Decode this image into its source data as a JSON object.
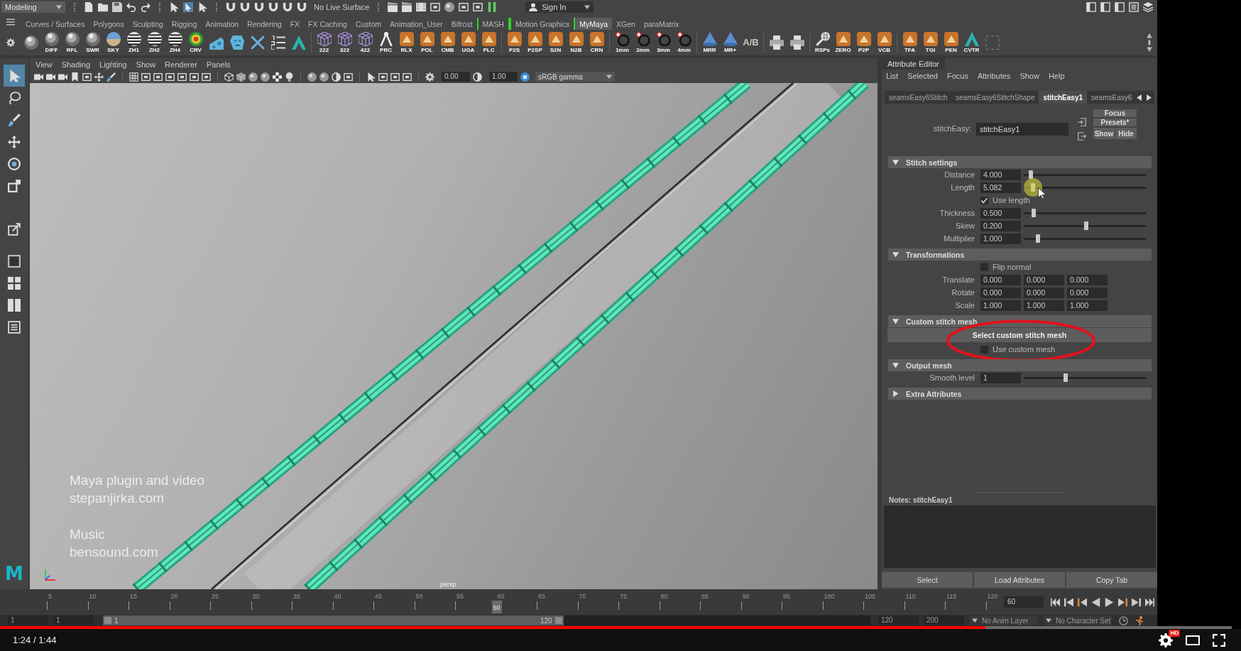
{
  "status_line": {
    "workspace": "Modeling",
    "live_surface": "No Live Surface",
    "sign_in": "Sign In"
  },
  "shelf": {
    "tabs": [
      {
        "label": "Curves / Surfaces",
        "selected": false,
        "bracketed": false
      },
      {
        "label": "Polygons",
        "selected": false,
        "bracketed": false
      },
      {
        "label": "Sculpting",
        "selected": false,
        "bracketed": false
      },
      {
        "label": "Rigging",
        "selected": false,
        "bracketed": false
      },
      {
        "label": "Animation",
        "selected": false,
        "bracketed": false
      },
      {
        "label": "Rendering",
        "selected": false,
        "bracketed": false
      },
      {
        "label": "FX",
        "selected": false,
        "bracketed": false
      },
      {
        "label": "FX Caching",
        "selected": false,
        "bracketed": false
      },
      {
        "label": "Custom",
        "selected": false,
        "bracketed": false
      },
      {
        "label": "Animation_User",
        "selected": false,
        "bracketed": false
      },
      {
        "label": "Bifrost",
        "selected": false,
        "bracketed": false
      },
      {
        "label": "MASH",
        "selected": false,
        "bracketed": true
      },
      {
        "label": "Motion Graphics",
        "selected": false,
        "bracketed": true
      },
      {
        "label": "MyMaya",
        "selected": true,
        "bracketed": false
      },
      {
        "label": "XGen",
        "selected": false,
        "bracketed": false
      },
      {
        "label": "paraMatrix",
        "selected": false,
        "bracketed": false
      }
    ],
    "groups": [
      [
        {
          "kind": "ball"
        },
        {
          "kind": "ball",
          "label": "DIFF"
        },
        {
          "kind": "ball",
          "label": "RFL"
        },
        {
          "kind": "ball",
          "label": "SWR"
        },
        {
          "kind": "sky",
          "label": "SKY"
        },
        {
          "kind": "zebra",
          "label": "ZH1"
        },
        {
          "kind": "zebra",
          "label": "ZH2"
        },
        {
          "kind": "zebra",
          "label": "ZH4"
        },
        {
          "kind": "rainbow",
          "label": "CRV"
        },
        {
          "kind": "wedge"
        },
        {
          "kind": "head"
        },
        {
          "kind": "tools"
        },
        {
          "kind": "list"
        },
        {
          "kind": "arch"
        }
      ],
      [
        {
          "kind": "cube",
          "label": "222"
        },
        {
          "kind": "cube",
          "label": "322"
        },
        {
          "kind": "cube",
          "label": "422"
        },
        {
          "kind": "compass",
          "label": "PRC"
        },
        {
          "kind": "tile",
          "label": "RLX"
        },
        {
          "kind": "tile",
          "label": "POL"
        },
        {
          "kind": "tile",
          "label": "CMB"
        },
        {
          "kind": "tile",
          "label": "UGA"
        },
        {
          "kind": "tile",
          "label": "PLC"
        }
      ],
      [
        {
          "kind": "tile",
          "label": "P2S"
        },
        {
          "kind": "tile",
          "label": "P2SP"
        },
        {
          "kind": "tile",
          "label": "S2N"
        },
        {
          "kind": "tile",
          "label": "N2B"
        },
        {
          "kind": "tile",
          "label": "CRN"
        }
      ],
      [
        {
          "kind": "ring",
          "label": "1mm"
        },
        {
          "kind": "ring",
          "label": "2mm"
        },
        {
          "kind": "ring",
          "label": "3mm"
        },
        {
          "kind": "ring",
          "label": "4mm"
        }
      ],
      [
        {
          "kind": "cone",
          "label": "MRR"
        },
        {
          "kind": "cone",
          "label": "MR+"
        },
        {
          "kind": "letters",
          "label": "A/B"
        }
      ],
      [
        {
          "kind": "printer"
        },
        {
          "kind": "printer"
        }
      ],
      [
        {
          "kind": "mic",
          "label": "RSPs"
        },
        {
          "kind": "tile",
          "label": "ZERO"
        },
        {
          "kind": "tile",
          "label": "P2P"
        },
        {
          "kind": "tile",
          "label": "VCB"
        }
      ],
      [
        {
          "kind": "tile",
          "label": "TFA"
        },
        {
          "kind": "tile",
          "label": "TGI"
        },
        {
          "kind": "tile",
          "label": "PEN"
        },
        {
          "kind": "arch",
          "label": "CVTR"
        },
        {
          "kind": "slot"
        }
      ]
    ]
  },
  "toolbox": {
    "groups": [
      [
        {
          "kind": "select",
          "selected": true
        },
        {
          "kind": "lasso",
          "selected": false
        },
        {
          "kind": "paint",
          "selected": false
        },
        {
          "kind": "move",
          "selected": false
        },
        {
          "kind": "rotate",
          "selected": false
        },
        {
          "kind": "scale",
          "selected": false
        }
      ],
      [
        {
          "kind": "last",
          "selected": false
        }
      ],
      [
        {
          "kind": "single",
          "selected": false
        },
        {
          "kind": "four",
          "selected": false
        },
        {
          "kind": "two",
          "selected": false
        },
        {
          "kind": "outliner",
          "selected": false
        }
      ]
    ],
    "logo": "M"
  },
  "viewport": {
    "menu": [
      "View",
      "Shading",
      "Lighting",
      "Show",
      "Renderer",
      "Panels"
    ],
    "exposure": "0.00",
    "gamma": "1.00",
    "color_space": "sRGB gamma",
    "captions": [
      [
        "Maya plugin and video",
        "stepanjirka.com"
      ],
      [
        "Music",
        "bensound.com"
      ]
    ],
    "camera": "persp"
  },
  "attribute_editor": {
    "title": "Attribute Editor",
    "menu": [
      "List",
      "Selected",
      "Focus",
      "Attributes",
      "Show",
      "Help"
    ],
    "node_tabs": [
      {
        "label": "seamsEasy6Stitch",
        "selected": false
      },
      {
        "label": "seamsEasy6StitchShape",
        "selected": false
      },
      {
        "label": "stitchEasy1",
        "selected": true
      },
      {
        "label": "seamsEasy6",
        "selected": false
      }
    ],
    "node_label": "stitchEasy:",
    "node_name": "stitchEasy1",
    "actions": [
      "Focus",
      "Presets*"
    ],
    "visibility": [
      "Show",
      "Hide"
    ],
    "sections": [
      {
        "title": "Stitch settings",
        "expanded": true,
        "annotated": false,
        "rows": [
          {
            "kind": "slider",
            "label": "Distance",
            "value": "4.000",
            "level": 0.04,
            "pointer": false
          },
          {
            "kind": "slider",
            "label": "Length",
            "value": "5.082",
            "level": 0.06,
            "pointer": true
          },
          {
            "kind": "checkbox",
            "label": "Use length",
            "checked": true
          },
          {
            "kind": "slider",
            "label": "Thickness",
            "value": "0.500",
            "level": 0.065,
            "pointer": false
          },
          {
            "kind": "slider",
            "label": "Skew",
            "value": "0.200",
            "level": 0.51,
            "pointer": false
          },
          {
            "kind": "slider",
            "label": "Multiplier",
            "value": "1.000",
            "level": 0.1,
            "pointer": false
          }
        ]
      },
      {
        "title": "Transformations",
        "expanded": true,
        "annotated": false,
        "rows": [
          {
            "kind": "checkbox",
            "label": "Flip normal",
            "checked": false
          },
          {
            "kind": "vector",
            "label": "Translate",
            "values": [
              "0.000",
              "0.000",
              "0.000"
            ]
          },
          {
            "kind": "vector",
            "label": "Rotate",
            "values": [
              "0.000",
              "0.000",
              "0.000"
            ]
          },
          {
            "kind": "vector",
            "label": "Scale",
            "values": [
              "1.000",
              "1.000",
              "1.000"
            ]
          }
        ]
      },
      {
        "title": "Custom stitch mesh",
        "expanded": true,
        "annotated": true,
        "rows": [
          {
            "kind": "button",
            "label": "Select custom stitch mesh"
          },
          {
            "kind": "checkbox",
            "label": "Use custom mesh",
            "checked": false
          }
        ]
      },
      {
        "title": "Output mesh",
        "expanded": true,
        "annotated": false,
        "rows": [
          {
            "kind": "slider",
            "label": "Smooth level",
            "value": "1",
            "level": 0.34,
            "pointer": false
          }
        ]
      },
      {
        "title": "Extra Attributes",
        "expanded": false,
        "annotated": false
      }
    ],
    "notes_label": "Notes: stitchEasy1",
    "buttons": [
      "Select",
      "Load Attributes",
      "Copy Tab"
    ]
  },
  "timeline": {
    "ticks": [
      "5",
      "10",
      "15",
      "20",
      "25",
      "30",
      "35",
      "40",
      "45",
      "50",
      "55",
      "60",
      "65",
      "70",
      "75",
      "80",
      "85",
      "90",
      "95",
      "100",
      "105",
      "110",
      "115",
      "120"
    ],
    "level": 0.496,
    "marker": "60",
    "current_frame": "60"
  },
  "range": {
    "start": "1",
    "playback_start": "1",
    "bar_start": "1",
    "bar_end": "120",
    "level": 0.6,
    "playback_end": "120",
    "end": "200",
    "anim_layer": "No Anim Layer",
    "character_set": "No Character Set"
  },
  "player": {
    "time": "1:24 / 1:44",
    "level": 0.8,
    "badge": "HD"
  }
}
